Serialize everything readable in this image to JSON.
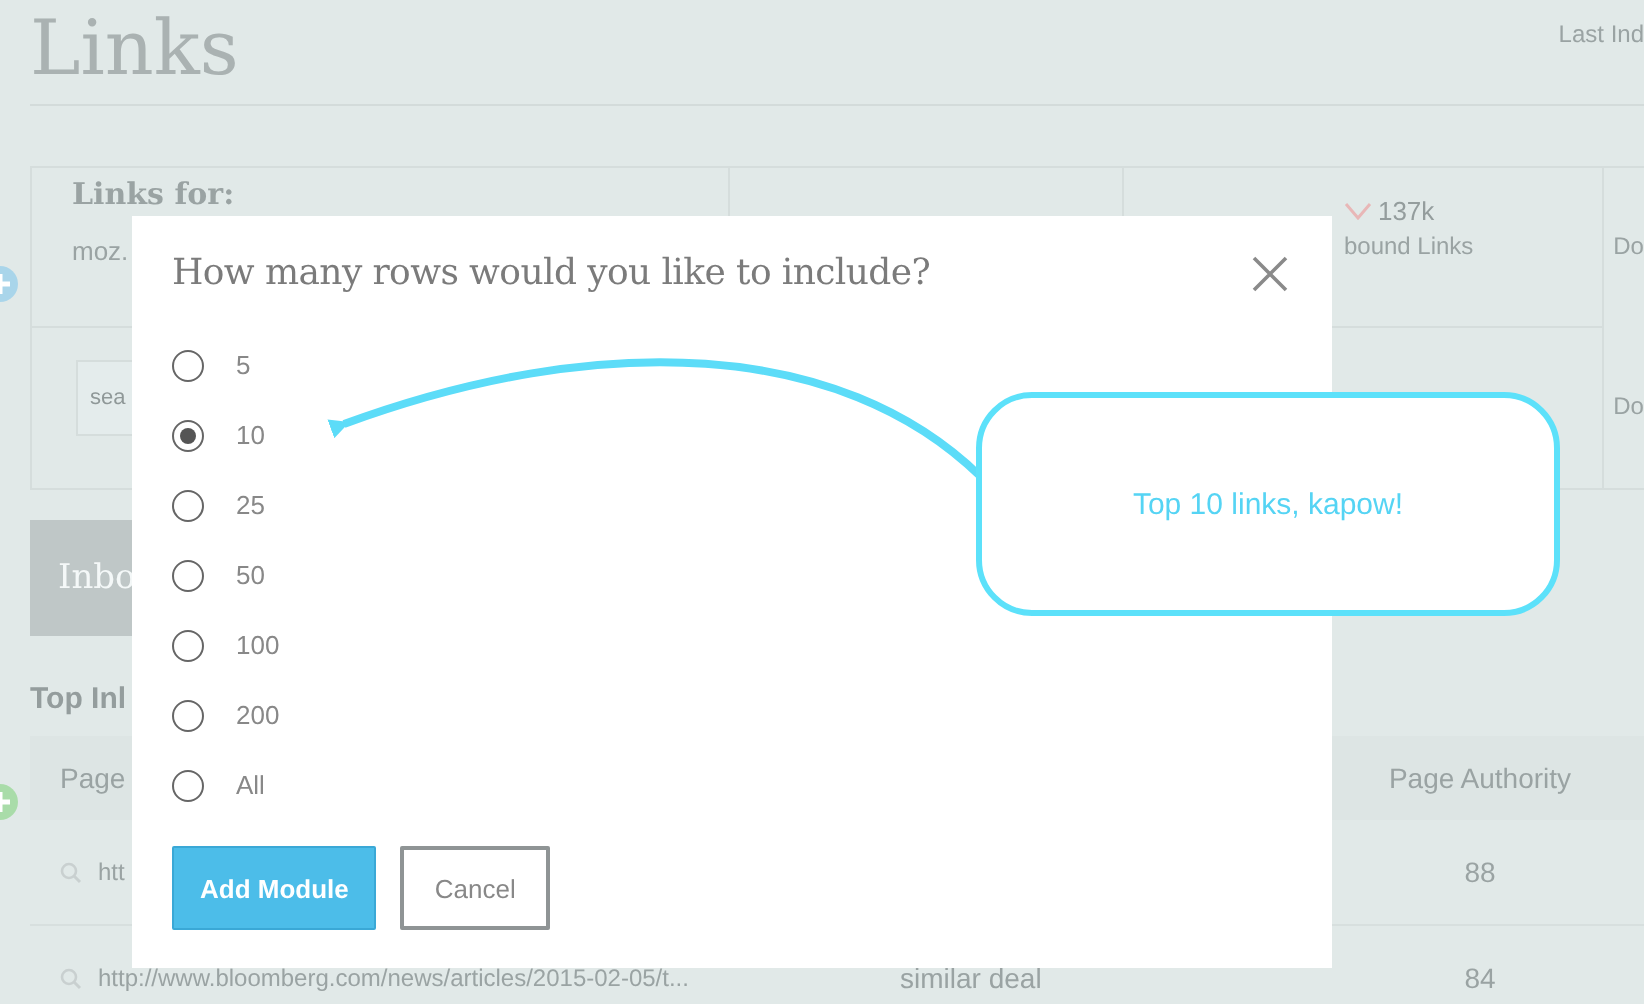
{
  "page": {
    "title": "Links",
    "last_indexed": "Last Ind"
  },
  "summary": {
    "links_for_label": "Links for:",
    "domain": "moz.",
    "search": {
      "placeholder": "sea"
    },
    "metric": {
      "change": "137k",
      "label": "bound Links"
    },
    "column_labels": [
      "Do",
      "Do"
    ]
  },
  "inbound_tab": "Inbo",
  "section_title": "Top Inl",
  "table": {
    "columns": [
      "Page",
      "Page Authority"
    ],
    "rows": [
      {
        "url": "htt",
        "page_authority": "88"
      },
      {
        "url": "http://www.bloomberg.com/news/articles/2015-02-05/t...",
        "column_2": "similar deal",
        "page_authority": "84"
      }
    ]
  },
  "dialog": {
    "title": "How many rows would you like to include?",
    "options": [
      {
        "label": "5",
        "selected": false
      },
      {
        "label": "10",
        "selected": true
      },
      {
        "label": "25",
        "selected": false
      },
      {
        "label": "50",
        "selected": false
      },
      {
        "label": "100",
        "selected": false
      },
      {
        "label": "200",
        "selected": false
      },
      {
        "label": "All",
        "selected": false
      }
    ],
    "buttons": [
      {
        "label": "Add Module",
        "kind": "primary"
      },
      {
        "label": "Cancel",
        "kind": "secondary"
      }
    ]
  },
  "callout": {
    "text": "Top 10 links, kapow!"
  }
}
